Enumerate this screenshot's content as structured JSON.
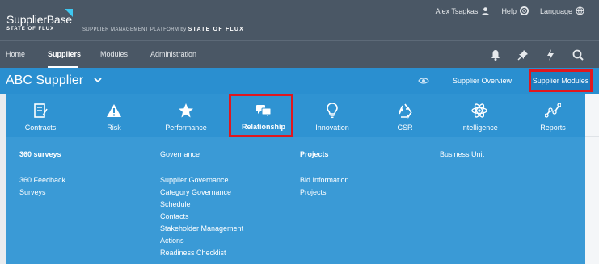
{
  "brand": {
    "logo_main": "SupplierBase",
    "logo_sub": "STATE OF FLUX",
    "platform_prefix": "SUPPLIER MANAGEMENT PLATFORM by",
    "platform_brand": "STATE OF FLUX"
  },
  "user_menu": {
    "user_name": "Alex Tsagkas",
    "help_label": "Help",
    "language_label": "Language"
  },
  "nav": {
    "items": [
      {
        "label": "Home",
        "active": false
      },
      {
        "label": "Suppliers",
        "active": true
      },
      {
        "label": "Modules",
        "active": false
      },
      {
        "label": "Administration",
        "active": false
      }
    ],
    "icons": [
      "bell-icon",
      "pin-icon",
      "lightning-icon",
      "search-icon"
    ]
  },
  "subbar": {
    "supplier_name": "ABC Supplier",
    "overview_label": "Supplier Overview",
    "modules_label": "Supplier Modules"
  },
  "modules": [
    {
      "label": "Contracts",
      "icon": "contracts-icon",
      "selected": false
    },
    {
      "label": "Risk",
      "icon": "warning-icon",
      "selected": false
    },
    {
      "label": "Performance",
      "icon": "star-icon",
      "selected": false
    },
    {
      "label": "Relationship",
      "icon": "chat-icon",
      "selected": true
    },
    {
      "label": "Innovation",
      "icon": "lightbulb-icon",
      "selected": false
    },
    {
      "label": "CSR",
      "icon": "recycle-icon",
      "selected": false
    },
    {
      "label": "Intelligence",
      "icon": "atom-icon",
      "selected": false
    },
    {
      "label": "Reports",
      "icon": "chart-line-icon",
      "selected": false
    }
  ],
  "menu": {
    "col1": {
      "heading": "360 surveys",
      "links": [
        "360 Feedback",
        "Surveys"
      ]
    },
    "col2": {
      "heading": "Governance",
      "links": [
        "Supplier Governance",
        "Category Governance",
        "Schedule",
        "Contacts",
        "Stakeholder Management",
        "Actions",
        "Readiness Checklist"
      ]
    },
    "col3": {
      "heading": "Projects",
      "links": [
        "Bid Information",
        "Projects"
      ]
    },
    "col4": {
      "heading": "Business Unit",
      "links": []
    }
  },
  "colors": {
    "header_bg": "#4a5765",
    "subbar_bg": "#2a8fd0",
    "panel_bg": "#3a9ad6",
    "highlight": "#e0171e",
    "logo_accent": "#3ec7f0"
  }
}
